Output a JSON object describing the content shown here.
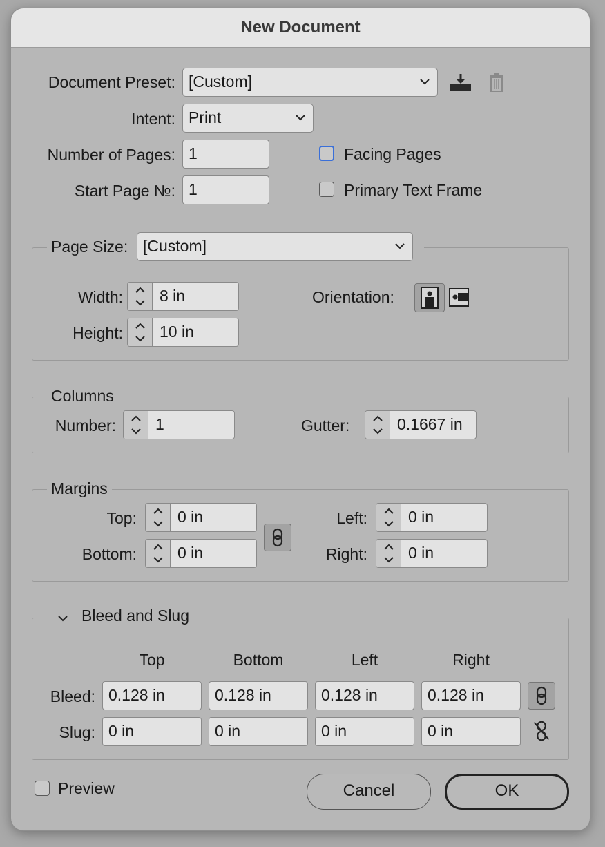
{
  "window": {
    "title": "New Document"
  },
  "preset": {
    "label": "Document Preset:",
    "value": "[Custom]",
    "icons": [
      "save-preset-icon",
      "delete-preset-icon"
    ]
  },
  "intent": {
    "label": "Intent:",
    "value": "Print"
  },
  "pages": {
    "label": "Number of Pages:",
    "value": "1"
  },
  "start_page": {
    "label": "Start Page №:",
    "value": "1"
  },
  "facing_pages": {
    "label": "Facing Pages",
    "checked": false
  },
  "primary_text_frame": {
    "label": "Primary Text Frame",
    "checked": false
  },
  "page_size": {
    "label": "Page Size:",
    "value": "[Custom]",
    "width_label": "Width:",
    "width": "8 in",
    "height_label": "Height:",
    "height": "10 in",
    "orientation_label": "Orientation:",
    "orientation_icons": [
      "portrait-icon",
      "landscape-icon"
    ],
    "orientation_selected": "portrait"
  },
  "columns": {
    "legend": "Columns",
    "number_label": "Number:",
    "number": "1",
    "gutter_label": "Gutter:",
    "gutter": "0.1667 in"
  },
  "margins": {
    "legend": "Margins",
    "top_label": "Top:",
    "top": "0 in",
    "bottom_label": "Bottom:",
    "bottom": "0 in",
    "left_label": "Left:",
    "left": "0 in",
    "right_label": "Right:",
    "right": "0 in",
    "linked": true
  },
  "bleed_slug": {
    "legend": "Bleed and Slug",
    "expanded": true,
    "columns": [
      "Top",
      "Bottom",
      "Left",
      "Right"
    ],
    "bleed_label": "Bleed:",
    "bleed": [
      "0.128 in",
      "0.128 in",
      "0.128 in",
      "0.128 in"
    ],
    "bleed_linked": true,
    "slug_label": "Slug:",
    "slug": [
      "0 in",
      "0 in",
      "0 in",
      "0 in"
    ],
    "slug_linked": false
  },
  "preview": {
    "label": "Preview",
    "checked": false
  },
  "buttons": {
    "cancel": "Cancel",
    "ok": "OK"
  }
}
